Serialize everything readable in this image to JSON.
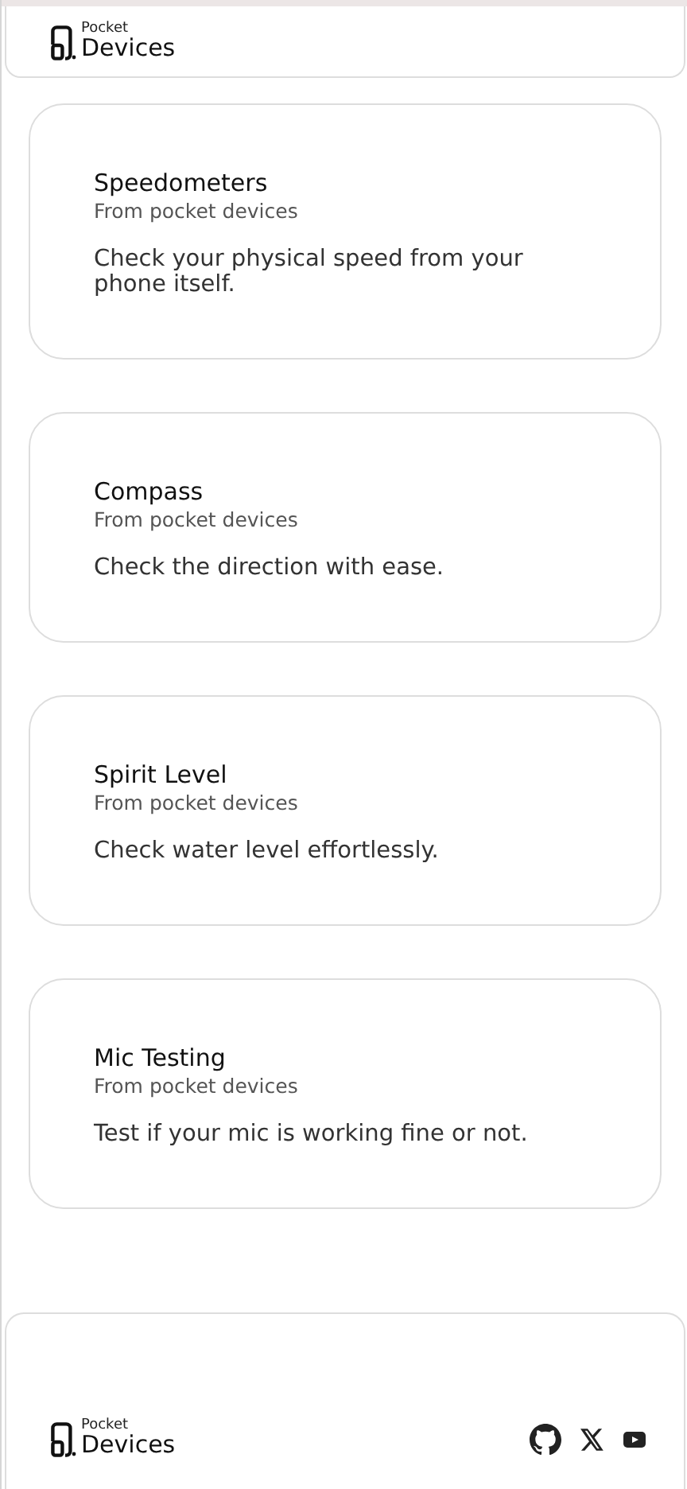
{
  "header": {
    "logo": {
      "small": "Pocket",
      "large": "Devices"
    }
  },
  "cards": [
    {
      "title": "Speedometers",
      "subtitle": "From pocket devices",
      "description": "Check your physical speed from your phone itself."
    },
    {
      "title": "Compass",
      "subtitle": "From pocket devices",
      "description": "Check the direction with ease."
    },
    {
      "title": "Spirit Level",
      "subtitle": "From pocket devices",
      "description": "Check water level effortlessly."
    },
    {
      "title": "Mic Testing",
      "subtitle": "From pocket devices",
      "description": "Test if your mic is working fine or not."
    }
  ],
  "footer": {
    "logo": {
      "small": "Pocket",
      "large": "Devices"
    },
    "social": [
      {
        "kind": "github"
      },
      {
        "kind": "x"
      },
      {
        "kind": "youtube"
      }
    ]
  }
}
